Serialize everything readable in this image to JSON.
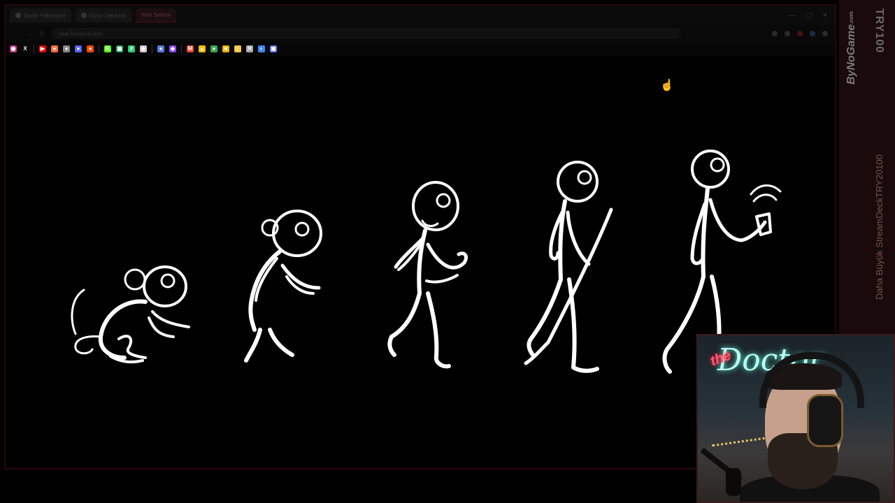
{
  "browser": {
    "tabs": [
      {
        "label": "Sayfa Yükleniyor"
      },
      {
        "label": "Oyun Sekmesi"
      },
      {
        "label": "Yeni Sekme"
      }
    ],
    "url": "neal.fun/evolution",
    "window_controls": [
      "—",
      "▢",
      "✕"
    ]
  },
  "bookmarks": [
    {
      "name": "instagram",
      "color": "#c13584",
      "glyph": "◉"
    },
    {
      "name": "x",
      "color": "#000000",
      "glyph": "X"
    },
    {
      "name": "youtube",
      "color": "#ff0000",
      "glyph": "▶"
    },
    {
      "name": "firefox",
      "color": "#ff7139",
      "glyph": "●"
    },
    {
      "name": "extension",
      "color": "#888888",
      "glyph": "●"
    },
    {
      "name": "discord",
      "color": "#5865f2",
      "glyph": "●"
    },
    {
      "name": "reddit",
      "color": "#ff4500",
      "glyph": "●"
    },
    {
      "name": "kick",
      "color": "#53fc18",
      "glyph": "K"
    },
    {
      "name": "sheets",
      "color": "#0f9d58",
      "glyph": "▦"
    },
    {
      "name": "hashtag",
      "color": "#2ecc71",
      "glyph": "#"
    },
    {
      "name": "diamond",
      "color": "#cccccc",
      "glyph": "◆"
    },
    {
      "name": "gamepad",
      "color": "#5a7bd8",
      "glyph": "●"
    },
    {
      "name": "twitch-like",
      "color": "#9146ff",
      "glyph": "◆"
    },
    {
      "name": "gmail",
      "color": "#ea4335",
      "glyph": "M"
    },
    {
      "name": "drive",
      "color": "#fbbc04",
      "glyph": "▲"
    },
    {
      "name": "chrome",
      "color": "#34a853",
      "glyph": "●"
    },
    {
      "name": "notes",
      "color": "#f4b400",
      "glyph": "■"
    },
    {
      "name": "music",
      "color": "#f5c542",
      "glyph": "♫"
    },
    {
      "name": "tool",
      "color": "#aaaaaa",
      "glyph": "✕"
    },
    {
      "name": "globe",
      "color": "#4285f4",
      "glyph": "◐"
    },
    {
      "name": "trello",
      "color": "#5b6cff",
      "glyph": "▣"
    }
  ],
  "overlay": {
    "side_logo": "ByNoGame",
    "side_logo_suffix": ".com",
    "side_try": "TRY100",
    "side_promo": "Daha Büyük StreamDeckTRY20100"
  },
  "webcam": {
    "neon_the": "the",
    "neon_doctor": "Doctor"
  },
  "stage": {
    "figures": [
      "monkey-crouching",
      "monkey-standing",
      "early-human",
      "human-with-staff",
      "human-with-phone"
    ]
  }
}
